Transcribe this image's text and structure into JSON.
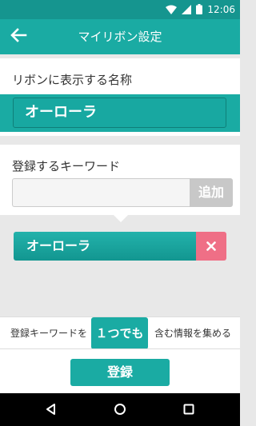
{
  "status_bar": {
    "time": "12:06",
    "icons": [
      "wifi-icon",
      "signal-icon",
      "battery-icon"
    ]
  },
  "app_bar": {
    "title": "マイリボン設定",
    "back_icon": "arrow-left-icon"
  },
  "ribbon_name": {
    "label": "リボンに表示する名称",
    "value": "オーローラ"
  },
  "keyword_entry": {
    "label": "登録するキーワード",
    "input_value": "",
    "add_label": "追加"
  },
  "keywords": [
    {
      "text": "オーローラ",
      "remove_icon": "close-icon"
    }
  ],
  "condition": {
    "prefix": "登録キーワードを",
    "toggle_label": "１つでも",
    "suffix": "含む情報を集める"
  },
  "footer": {
    "register_label": "登録"
  },
  "nav_bar": {
    "icons": [
      "back-triangle-icon",
      "home-circle-icon",
      "recents-square-icon"
    ]
  },
  "colors": {
    "primary": "#1aaba3",
    "status_bar": "#15958f",
    "remove": "#ef6f86",
    "add_disabled": "#c8c8c8",
    "background": "#e8e8e8"
  }
}
